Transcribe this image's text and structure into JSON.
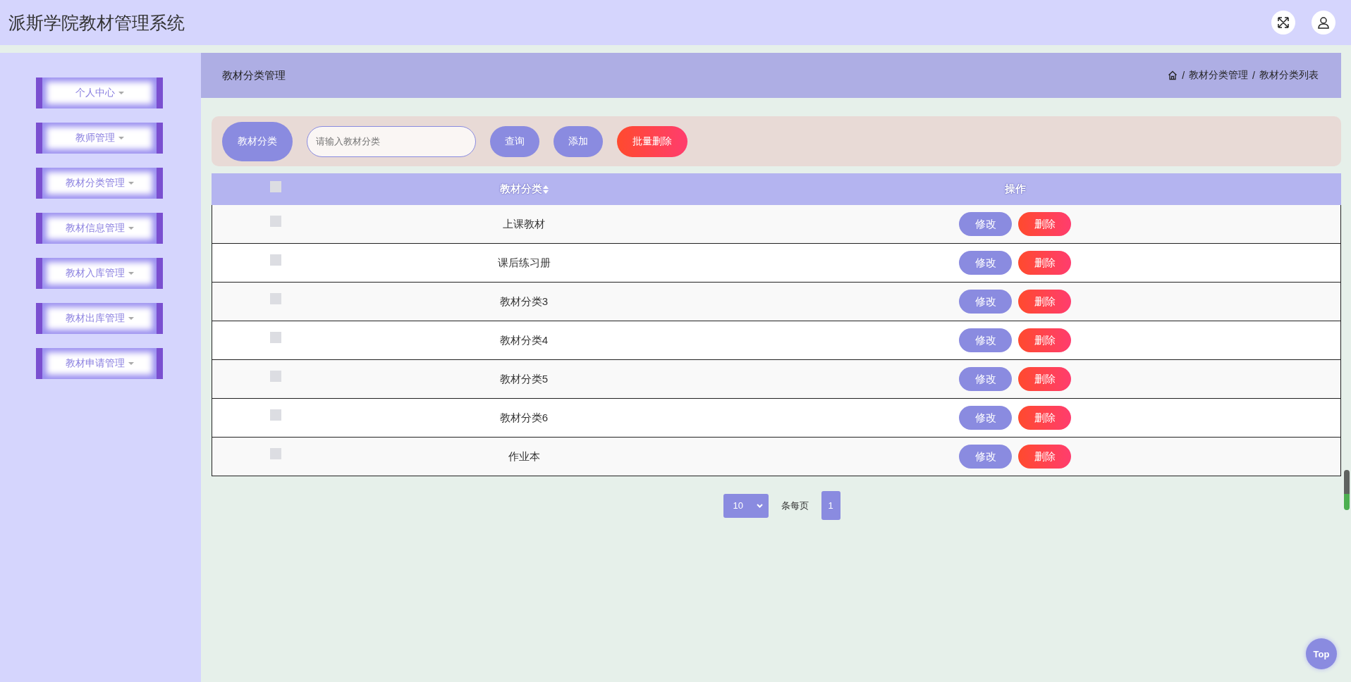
{
  "header": {
    "title": "派斯学院教材管理系统"
  },
  "sidebar": {
    "items": [
      {
        "label": "个人中心"
      },
      {
        "label": "教师管理"
      },
      {
        "label": "教材分类管理"
      },
      {
        "label": "教材信息管理"
      },
      {
        "label": "教材入库管理"
      },
      {
        "label": "教材出库管理"
      },
      {
        "label": "教材申请管理"
      }
    ]
  },
  "page_title": "教材分类管理",
  "breadcrumb": [
    {
      "separator": "/",
      "label": "教材分类管理"
    },
    {
      "separator": "/",
      "label": "教材分类列表"
    }
  ],
  "search": {
    "label": "教材分类",
    "placeholder": "请输入教材分类",
    "buttons": [
      {
        "label": "查询",
        "kind": "primary"
      },
      {
        "label": "添加",
        "kind": "primary"
      },
      {
        "label": "批量删除",
        "kind": "danger"
      }
    ]
  },
  "table": {
    "columns": [
      "教材分类",
      "操作"
    ],
    "header_checked": false,
    "rows": [
      {
        "category": "上课教材",
        "checked": false,
        "actions": [
          "修改",
          "删除"
        ]
      },
      {
        "category": "课后练习册",
        "checked": false,
        "actions": [
          "修改",
          "删除"
        ]
      },
      {
        "category": "教材分类3",
        "checked": false,
        "actions": [
          "修改",
          "删除"
        ]
      },
      {
        "category": "教材分类4",
        "checked": false,
        "actions": [
          "修改",
          "删除"
        ]
      },
      {
        "category": "教材分类5",
        "checked": false,
        "actions": [
          "修改",
          "删除"
        ]
      },
      {
        "category": "教材分类6",
        "checked": false,
        "actions": [
          "修改",
          "删除"
        ]
      },
      {
        "category": "作业本",
        "checked": false,
        "actions": [
          "修改",
          "删除"
        ]
      }
    ]
  },
  "pagination": {
    "page_size": "10",
    "per_page_label": "条每页",
    "pages": [
      {
        "label": "1",
        "selected": true
      }
    ]
  },
  "top_button": "Top"
}
